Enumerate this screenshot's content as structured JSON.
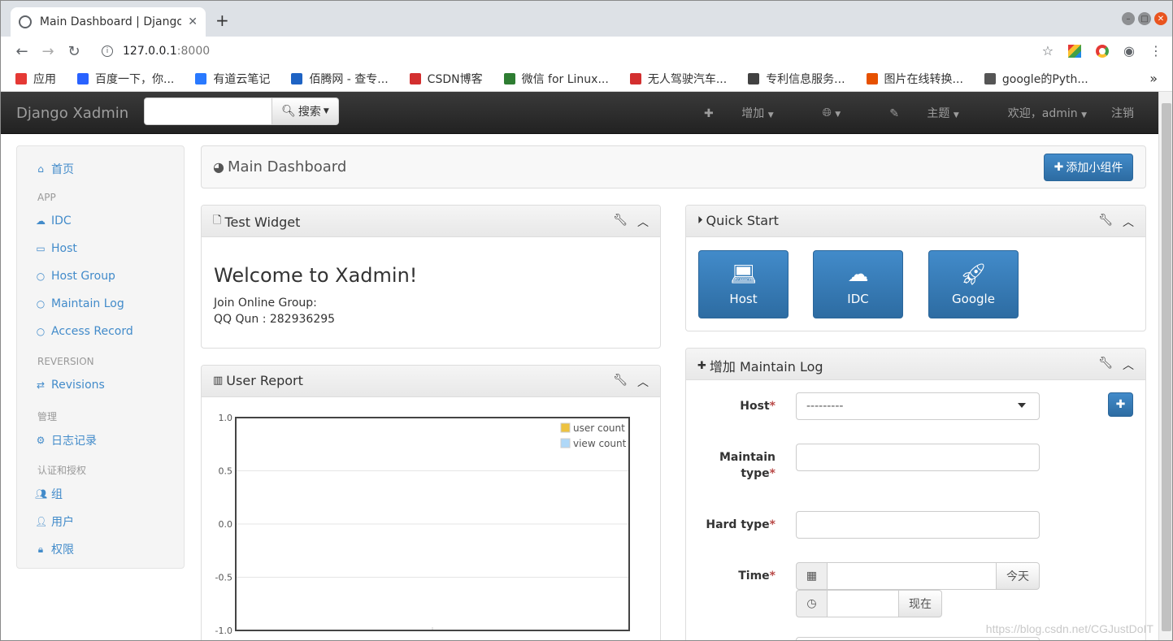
{
  "browser": {
    "tab_title": "Main Dashboard | Django",
    "url_host": "127.0.0.1",
    "url_port": ":8000",
    "bookmarks": [
      {
        "label": "应用",
        "color": "#e53935"
      },
      {
        "label": "百度一下，你...",
        "color": "#2962ff"
      },
      {
        "label": "有道云笔记",
        "color": "#2979ff"
      },
      {
        "label": "佰腾网 - 查专...",
        "color": "#1e63c4"
      },
      {
        "label": "CSDN博客",
        "color": "#d32f2f"
      },
      {
        "label": "微信 for Linux...",
        "color": "#2e7d32"
      },
      {
        "label": "无人驾驶汽车...",
        "color": "#d32f2f"
      },
      {
        "label": "专利信息服务...",
        "color": "#424242"
      },
      {
        "label": "图片在线转换...",
        "color": "#e65100"
      },
      {
        "label": "google的Pyth...",
        "color": "#555555"
      }
    ]
  },
  "navbar": {
    "brand": "Django Xadmin",
    "search_button": "搜索",
    "add": "增加",
    "theme": "主题",
    "welcome": "欢迎，admin",
    "logout": "注销"
  },
  "sidebar": {
    "home": "首页",
    "sections": [
      {
        "header": "APP",
        "items": [
          {
            "label": "IDC",
            "icon": "cloud-icon"
          },
          {
            "label": "Host",
            "icon": "laptop-icon"
          },
          {
            "label": "Host Group",
            "icon": "circle-icon"
          },
          {
            "label": "Maintain Log",
            "icon": "circle-icon"
          },
          {
            "label": "Access Record",
            "icon": "circle-icon"
          }
        ]
      },
      {
        "header": "REVERSION",
        "items": [
          {
            "label": "Revisions",
            "icon": "exchange-icon"
          }
        ]
      },
      {
        "header": "管理",
        "items": [
          {
            "label": "日志记录",
            "icon": "cog-icon"
          }
        ]
      },
      {
        "header": "认证和授权",
        "items": [
          {
            "label": "组",
            "icon": "group-icon"
          },
          {
            "label": "用户",
            "icon": "user-icon"
          },
          {
            "label": "权限",
            "icon": "lock-icon"
          }
        ]
      }
    ]
  },
  "dashboard": {
    "title": "Main Dashboard",
    "add_widget": "添加小组件"
  },
  "test_widget": {
    "title": "Test Widget",
    "heading": "Welcome to Xadmin!",
    "line1": "Join Online Group:",
    "line2": "QQ Qun : 282936295"
  },
  "user_report": {
    "title": "User Report"
  },
  "chart_data": {
    "type": "line",
    "title": "",
    "xlabel": "",
    "ylabel": "",
    "ylim": [
      -1.0,
      1.0
    ],
    "yticks": [
      "1.0",
      "0.5",
      "0.0",
      "-0.5",
      "-1.0"
    ],
    "grid": true,
    "legend_position": "top-right",
    "series": [
      {
        "name": "user count",
        "color": "#edc240",
        "values": []
      },
      {
        "name": "view count",
        "color": "#afd8f8",
        "values": []
      }
    ]
  },
  "quick_start": {
    "title": "Quick Start",
    "buttons": [
      {
        "label": "Host",
        "icon": "laptop-icon"
      },
      {
        "label": "IDC",
        "icon": "cloud-icon"
      },
      {
        "label": "Google",
        "icon": "rocket-icon"
      }
    ]
  },
  "maintain_form": {
    "title": "增加 Maintain Log",
    "host_label": "Host",
    "host_value": "---------",
    "maintain_type_label_1": "Maintain",
    "maintain_type_label_2": "type",
    "hard_type_label": "Hard type",
    "time_label": "Time",
    "today_button": "今天",
    "now_button": "现在",
    "required_mark": "*"
  },
  "watermark": "https://blog.csdn.net/CGJustDoIT"
}
